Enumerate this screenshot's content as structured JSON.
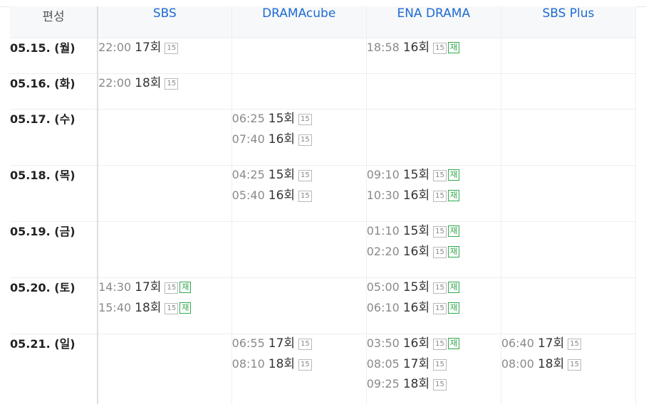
{
  "header": {
    "date_col": "편성",
    "channels": [
      "SBS",
      "DRAMAcube",
      "ENA DRAMA",
      "SBS Plus"
    ]
  },
  "colors": {
    "channel_link": "#1d6bd0",
    "rerun_badge": "#30a84c"
  },
  "rows": [
    {
      "date": "05.15. (월)",
      "cells": [
        [
          {
            "time": "22:00",
            "ep": "17회",
            "rating": "15",
            "rerun": ""
          }
        ],
        [],
        [
          {
            "time": "18:58",
            "ep": "16회",
            "rating": "15",
            "rerun": "재"
          }
        ],
        []
      ]
    },
    {
      "date": "05.16. (화)",
      "cells": [
        [
          {
            "time": "22:00",
            "ep": "18회",
            "rating": "15",
            "rerun": ""
          }
        ],
        [],
        [],
        []
      ]
    },
    {
      "date": "05.17. (수)",
      "cells": [
        [],
        [
          {
            "time": "06:25",
            "ep": "15회",
            "rating": "15",
            "rerun": ""
          },
          {
            "time": "07:40",
            "ep": "16회",
            "rating": "15",
            "rerun": ""
          }
        ],
        [],
        []
      ]
    },
    {
      "date": "05.18. (목)",
      "cells": [
        [],
        [
          {
            "time": "04:25",
            "ep": "15회",
            "rating": "15",
            "rerun": ""
          },
          {
            "time": "05:40",
            "ep": "16회",
            "rating": "15",
            "rerun": ""
          }
        ],
        [
          {
            "time": "09:10",
            "ep": "15회",
            "rating": "15",
            "rerun": "재"
          },
          {
            "time": "10:30",
            "ep": "16회",
            "rating": "15",
            "rerun": "재"
          }
        ],
        []
      ]
    },
    {
      "date": "05.19. (금)",
      "cells": [
        [],
        [],
        [
          {
            "time": "01:10",
            "ep": "15회",
            "rating": "15",
            "rerun": "재"
          },
          {
            "time": "02:20",
            "ep": "16회",
            "rating": "15",
            "rerun": "재"
          }
        ],
        []
      ]
    },
    {
      "date": "05.20. (토)",
      "cells": [
        [
          {
            "time": "14:30",
            "ep": "17회",
            "rating": "15",
            "rerun": "재"
          },
          {
            "time": "15:40",
            "ep": "18회",
            "rating": "15",
            "rerun": "재"
          }
        ],
        [],
        [
          {
            "time": "05:00",
            "ep": "15회",
            "rating": "15",
            "rerun": "재"
          },
          {
            "time": "06:10",
            "ep": "16회",
            "rating": "15",
            "rerun": "재"
          }
        ],
        []
      ]
    },
    {
      "date": "05.21. (일)",
      "cells": [
        [],
        [
          {
            "time": "06:55",
            "ep": "17회",
            "rating": "15",
            "rerun": ""
          },
          {
            "time": "08:10",
            "ep": "18회",
            "rating": "15",
            "rerun": ""
          }
        ],
        [
          {
            "time": "03:50",
            "ep": "16회",
            "rating": "15",
            "rerun": "재"
          },
          {
            "time": "08:05",
            "ep": "17회",
            "rating": "15",
            "rerun": ""
          },
          {
            "time": "09:25",
            "ep": "18회",
            "rating": "15",
            "rerun": ""
          }
        ],
        [
          {
            "time": "06:40",
            "ep": "17회",
            "rating": "15",
            "rerun": ""
          },
          {
            "time": "08:00",
            "ep": "18회",
            "rating": "15",
            "rerun": ""
          }
        ]
      ]
    }
  ]
}
